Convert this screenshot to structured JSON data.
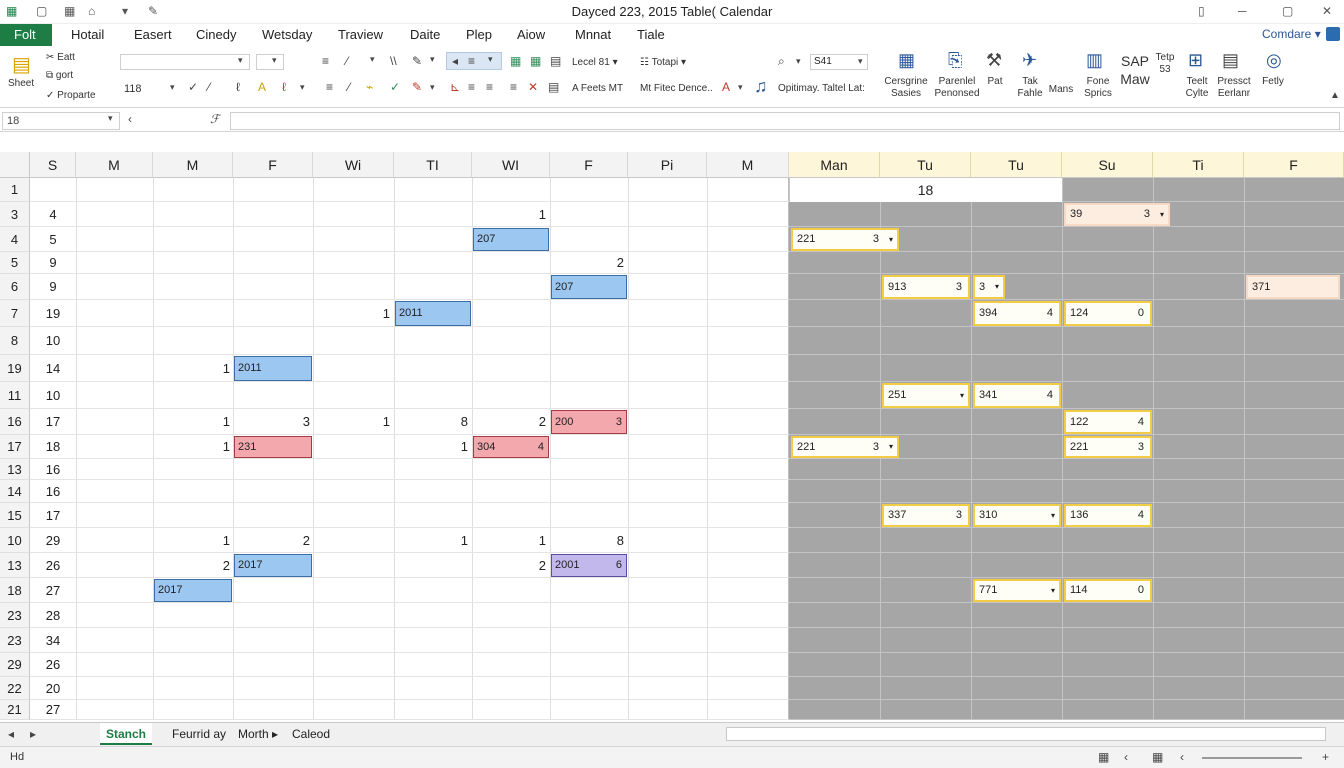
{
  "window": {
    "title": "Dayced 223, 2015 Table( Calendar"
  },
  "menu": {
    "file": "Folt",
    "tabs": [
      "Hotail",
      "Easert",
      "Cinedy",
      "Wetsday",
      "Traview",
      "Daite",
      "Plep",
      "Aiow",
      "Mnnat",
      "Tiale"
    ],
    "compare": "Comdare"
  },
  "ribbon": {
    "clipboard": {
      "sheet": "Sheet",
      "edit": "Eatt",
      "sort": "gort",
      "properties": "Proparte"
    },
    "font_size": "118",
    "align_text": "Lecel 81",
    "topics": "Totapi",
    "filter_label": "A Feets MT",
    "filter_dense": "Mt Fitec Dence..",
    "optimize": "Opitimay. Taltel Lat:",
    "search_value": "S41",
    "groups": [
      "Cersgrine Sasies",
      "Parenlel Penonsed",
      "Pat",
      "Tak Fahle",
      "Mans",
      "Fone Sprics",
      "SAP Maw",
      "Tetp 53",
      "Teelt Cylte",
      "Pressct Eerlanr",
      "Fetly"
    ]
  },
  "formula": {
    "name_box": "18"
  },
  "grid": {
    "left_headers": [
      "S",
      "M",
      "M",
      "F",
      "Wi",
      "TI",
      "WI",
      "F",
      "Pi",
      "M"
    ],
    "right_headers": [
      "Man",
      "Tu",
      "Tu",
      "Su",
      "Ti",
      "F"
    ],
    "row_numbers": [
      "1",
      "3",
      "4",
      "5",
      "6",
      "7",
      "8",
      "19",
      "11",
      "16",
      "17",
      "13",
      "14",
      "15",
      "10",
      "13",
      "18",
      "23",
      "23",
      "29",
      "22",
      "21"
    ],
    "col_s_values": [
      "",
      "4",
      "5",
      "9",
      "9",
      "19",
      "10",
      "14",
      "10",
      "17",
      "18",
      "16",
      "16",
      "17",
      "29",
      "26",
      "27",
      "28",
      "34",
      "26",
      "20",
      "27"
    ],
    "right_top_value": "18",
    "numbers": [
      {
        "id": "n1",
        "v": "1"
      },
      {
        "id": "n2",
        "v": "2"
      },
      {
        "id": "n3",
        "v": "1"
      },
      {
        "id": "n4",
        "v": "1"
      },
      {
        "id": "n5",
        "v": "1"
      },
      {
        "id": "n6",
        "v": "3"
      },
      {
        "id": "n7",
        "v": "1"
      },
      {
        "id": "n8",
        "v": "8"
      },
      {
        "id": "n9",
        "v": "2"
      },
      {
        "id": "n10",
        "v": "1"
      },
      {
        "id": "n11",
        "v": "1"
      },
      {
        "id": "n12",
        "v": "1"
      },
      {
        "id": "n13",
        "v": "2"
      },
      {
        "id": "n14",
        "v": "1"
      },
      {
        "id": "n15",
        "v": "1"
      },
      {
        "id": "n16",
        "v": "8"
      },
      {
        "id": "n17",
        "v": "2"
      },
      {
        "id": "n18",
        "v": "2"
      }
    ],
    "events": [
      {
        "label": "207",
        "n": "",
        "color": "blue"
      },
      {
        "label": "207",
        "n": "",
        "color": "blue"
      },
      {
        "label": "2011",
        "n": "",
        "color": "blue"
      },
      {
        "label": "2011",
        "n": "",
        "color": "blue"
      },
      {
        "label": "200",
        "n": "3",
        "color": "red"
      },
      {
        "label": "231",
        "n": "",
        "color": "red"
      },
      {
        "label": "304",
        "n": "4",
        "color": "red"
      },
      {
        "label": "2017",
        "n": "",
        "color": "blue"
      },
      {
        "label": "2001",
        "n": "6",
        "color": "purple"
      },
      {
        "label": "2017",
        "n": "",
        "color": "blue"
      }
    ],
    "right_events": [
      {
        "label": "39",
        "n": "3"
      },
      {
        "label": "221",
        "n": "3"
      },
      {
        "label": "913",
        "n": "3"
      },
      {
        "label": "3",
        "n": ""
      },
      {
        "label": "371",
        "n": ""
      },
      {
        "label": "394",
        "n": "4"
      },
      {
        "label": "124",
        "n": "0"
      },
      {
        "label": "251",
        "n": ""
      },
      {
        "label": "341",
        "n": "4"
      },
      {
        "label": "122",
        "n": "4"
      },
      {
        "label": "221",
        "n": "3"
      },
      {
        "label": "221",
        "n": "3"
      },
      {
        "label": "337",
        "n": "3"
      },
      {
        "label": "310",
        "n": ""
      },
      {
        "label": "136",
        "n": "4"
      },
      {
        "label": "771",
        "n": ""
      },
      {
        "label": "114",
        "n": "0"
      }
    ]
  },
  "sheets": [
    "Stanch",
    "Feurrid ay",
    "Morth",
    "Caleod"
  ],
  "status": {
    "left": "Hd"
  }
}
